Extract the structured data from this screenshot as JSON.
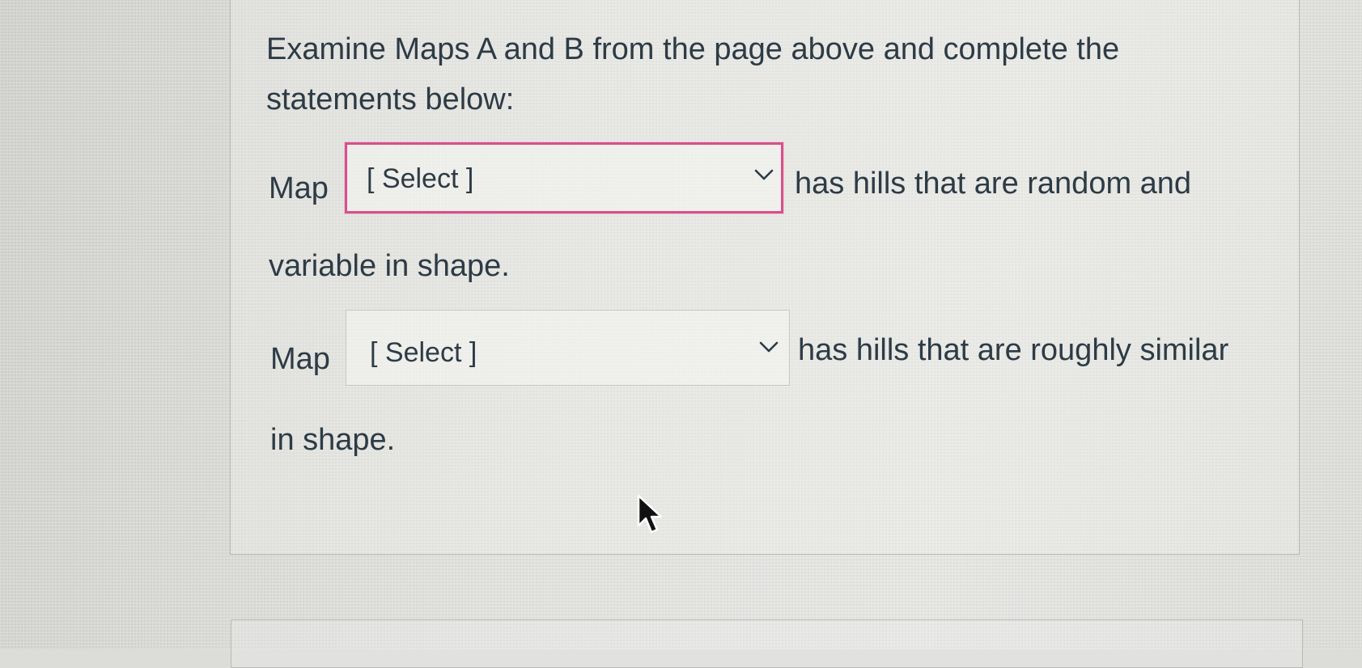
{
  "question": {
    "prompt": "Examine Maps A and B from the page above and complete the statements below:"
  },
  "statement1": {
    "prefix": "Map",
    "dropdown_value": "[ Select ]",
    "suffix_line1": "has hills that are random and",
    "suffix_line2": "variable in shape."
  },
  "statement2": {
    "prefix": "Map",
    "dropdown_value": "[ Select ]",
    "suffix_line1": "has hills that are roughly similar",
    "suffix_line2": "in shape."
  },
  "colors": {
    "focus_border": "#d94f8a",
    "text": "#2d3b45",
    "border": "#c7c7c4"
  },
  "icons": {
    "dropdown": "chevron-down-icon",
    "pointer": "mouse-cursor-icon"
  }
}
